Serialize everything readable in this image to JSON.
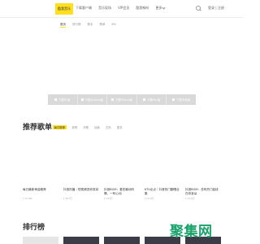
{
  "header": {
    "logo": "酷我音乐",
    "nav": [
      "下载客户端",
      "音乐现场",
      "VIP会员",
      "酷我畅听"
    ],
    "more": "更多",
    "login": "登录 | 注册"
  },
  "subnav": [
    "首页",
    "排行榜",
    "歌手",
    "歌单",
    "MV"
  ],
  "download_bar": [
    "下载PC版",
    "下载Android版",
    "下载iPhone版",
    "下载Mac版",
    "下载车机版"
  ],
  "playlists": {
    "title": "推荐歌单",
    "tabs": [
      "每日推荐",
      "新歌",
      "热歌",
      "经典",
      "古风",
      "更多"
    ],
    "items": [
      {
        "name": "每日最新单曲推荐",
        "plays": "13.3W"
      },
      {
        "name": "抖音热播｜短视频进你双耳",
        "plays": "457万"
      },
      {
        "name": "抖音BGM：爱恋最动听情、一听心动",
        "plays": "134万"
      },
      {
        "name": "KTV必点｜抖音热门翻唱合集",
        "plays": "14.4万"
      },
      {
        "name": "抖音BGM：总有热门曲线在你耳朵",
        "plays": "14.9万"
      }
    ]
  },
  "ranking": {
    "title": "排行榜"
  },
  "watermark": "聚集网"
}
